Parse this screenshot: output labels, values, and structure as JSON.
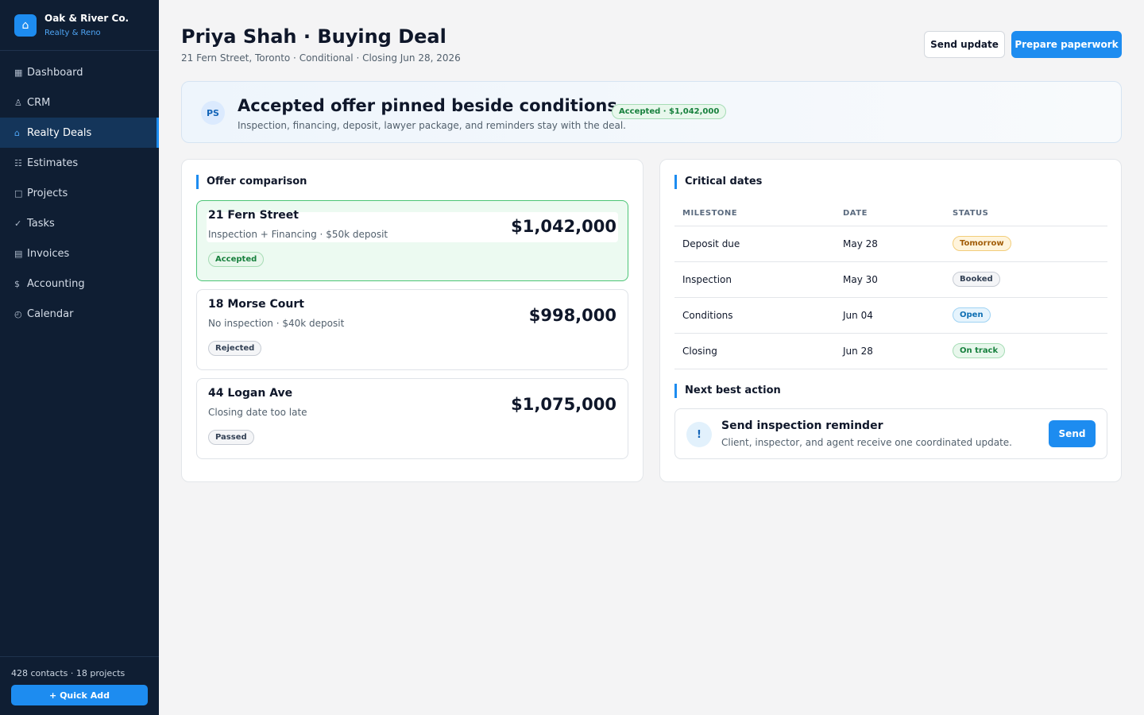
{
  "brand": {
    "logo_icon": "home-icon",
    "logo_glyph": "⌂",
    "name": "Oak & River Co.",
    "subtitle": "Realty & Reno"
  },
  "sidebar": {
    "items": [
      {
        "icon": "grid-icon",
        "glyph": "▦",
        "label": "Dashboard",
        "active": false
      },
      {
        "icon": "person-icon",
        "glyph": "♙",
        "label": "CRM",
        "active": false
      },
      {
        "icon": "home-icon",
        "glyph": "⌂",
        "label": "Realty Deals",
        "active": true
      },
      {
        "icon": "list-icon",
        "glyph": "☷",
        "label": "Estimates",
        "active": false
      },
      {
        "icon": "square-icon",
        "glyph": "□",
        "label": "Projects",
        "active": false
      },
      {
        "icon": "check-icon",
        "glyph": "✓",
        "label": "Tasks",
        "active": false
      },
      {
        "icon": "invoice-icon",
        "glyph": "▤",
        "label": "Invoices",
        "active": false
      },
      {
        "icon": "dollar-icon",
        "glyph": "$",
        "label": "Accounting",
        "active": false
      },
      {
        "icon": "clock-icon",
        "glyph": "◴",
        "label": "Calendar",
        "active": false
      }
    ],
    "footer_stats": "428 contacts · 18 projects",
    "quick_add_label": "+ Quick Add"
  },
  "header": {
    "title": "Priya Shah · Buying Deal",
    "subtitle": "21 Fern Street, Toronto · Conditional · Closing Jun 28, 2026",
    "send_update_label": "Send update",
    "prepare_paperwork_label": "Prepare paperwork"
  },
  "banner": {
    "avatar_initials": "PS",
    "title": "Accepted offer pinned beside conditions",
    "subtitle": "Inspection, financing, deposit, lawyer package, and reminders stay with the deal.",
    "badge": "Accepted · $1,042,000"
  },
  "offers": {
    "title": "Offer comparison",
    "items": [
      {
        "name": "21 Fern Street",
        "terms": "Inspection + Financing · $50k deposit",
        "price": "$1,042,000",
        "status": "Accepted"
      },
      {
        "name": "18 Morse Court",
        "terms": "No inspection · $40k deposit",
        "price": "$998,000",
        "status": "Rejected"
      },
      {
        "name": "44 Logan Ave",
        "terms": "Closing date too late",
        "price": "$1,075,000",
        "status": "Passed"
      }
    ]
  },
  "dates": {
    "title": "Critical dates",
    "columns": [
      "MILESTONE",
      "DATE",
      "STATUS"
    ],
    "rows": [
      {
        "milestone": "Deposit due",
        "date": "May 28",
        "status": "Tomorrow"
      },
      {
        "milestone": "Inspection",
        "date": "May 30",
        "status": "Booked"
      },
      {
        "milestone": "Conditions",
        "date": "Jun 04",
        "status": "Open"
      },
      {
        "milestone": "Closing",
        "date": "Jun 28",
        "status": "On track"
      }
    ]
  },
  "next_action": {
    "title": "Next best action",
    "icon": "exclamation-icon",
    "icon_glyph": "!",
    "action_title": "Send inspection reminder",
    "action_subtitle": "Client, inspector, and agent receive one coordinated update.",
    "button_label": "Send"
  },
  "colors": {
    "accent": "#1d8cf0",
    "sidebar_bg": "#0f1e33",
    "accepted_green": "#17803d",
    "amber": "#a15c07",
    "info_blue": "#0e6fb3"
  }
}
